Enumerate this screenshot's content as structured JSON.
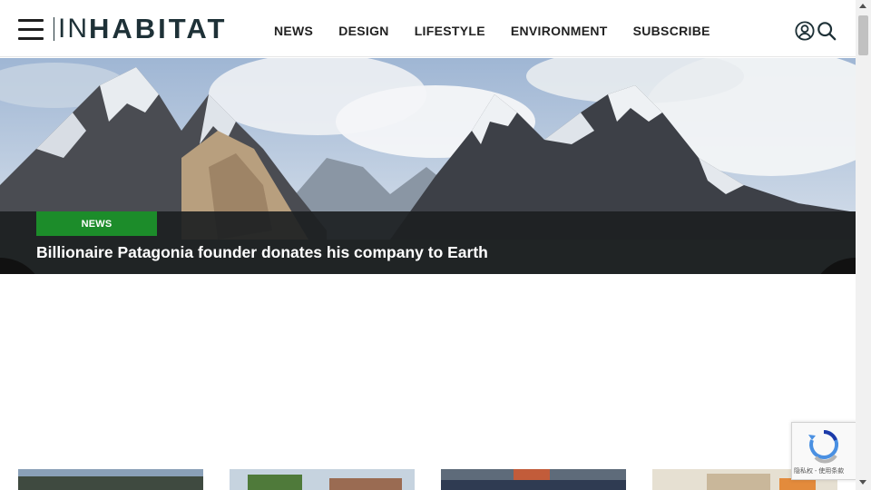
{
  "header": {
    "logo": {
      "in": "IN",
      "habitat": "HABITAT"
    },
    "nav": [
      "NEWS",
      "DESIGN",
      "LIFESTYLE",
      "ENVIRONMENT",
      "SUBSCRIBE"
    ],
    "icons": {
      "menu": "hamburger-menu-icon",
      "account": "user-account-icon",
      "search": "search-icon"
    }
  },
  "hero": {
    "category": "NEWS",
    "headline": "Billionaire Patagonia founder donates his company to Earth",
    "prev_arrow": "❮",
    "next_arrow": "❯"
  },
  "recaptcha": {
    "label": "隐私权 - 使用条款"
  },
  "colors": {
    "badge": "#1c8c2a",
    "logo": "#1e3137",
    "caption_bg": "#1c2022"
  }
}
